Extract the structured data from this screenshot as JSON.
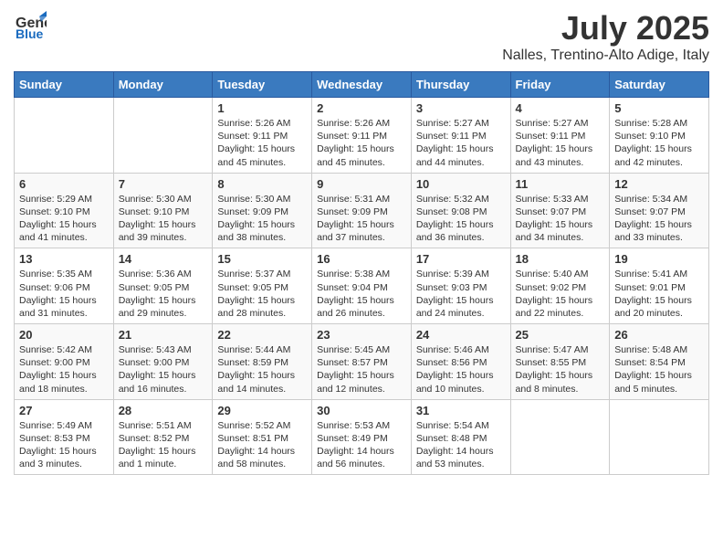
{
  "header": {
    "logo_general": "General",
    "logo_blue": "Blue",
    "title": "July 2025",
    "subtitle": "Nalles, Trentino-Alto Adige, Italy"
  },
  "days_of_week": [
    "Sunday",
    "Monday",
    "Tuesday",
    "Wednesday",
    "Thursday",
    "Friday",
    "Saturday"
  ],
  "weeks": [
    [
      {
        "day": "",
        "sunrise": "",
        "sunset": "",
        "daylight": ""
      },
      {
        "day": "",
        "sunrise": "",
        "sunset": "",
        "daylight": ""
      },
      {
        "day": "1",
        "sunrise": "Sunrise: 5:26 AM",
        "sunset": "Sunset: 9:11 PM",
        "daylight": "Daylight: 15 hours and 45 minutes."
      },
      {
        "day": "2",
        "sunrise": "Sunrise: 5:26 AM",
        "sunset": "Sunset: 9:11 PM",
        "daylight": "Daylight: 15 hours and 45 minutes."
      },
      {
        "day": "3",
        "sunrise": "Sunrise: 5:27 AM",
        "sunset": "Sunset: 9:11 PM",
        "daylight": "Daylight: 15 hours and 44 minutes."
      },
      {
        "day": "4",
        "sunrise": "Sunrise: 5:27 AM",
        "sunset": "Sunset: 9:11 PM",
        "daylight": "Daylight: 15 hours and 43 minutes."
      },
      {
        "day": "5",
        "sunrise": "Sunrise: 5:28 AM",
        "sunset": "Sunset: 9:10 PM",
        "daylight": "Daylight: 15 hours and 42 minutes."
      }
    ],
    [
      {
        "day": "6",
        "sunrise": "Sunrise: 5:29 AM",
        "sunset": "Sunset: 9:10 PM",
        "daylight": "Daylight: 15 hours and 41 minutes."
      },
      {
        "day": "7",
        "sunrise": "Sunrise: 5:30 AM",
        "sunset": "Sunset: 9:10 PM",
        "daylight": "Daylight: 15 hours and 39 minutes."
      },
      {
        "day": "8",
        "sunrise": "Sunrise: 5:30 AM",
        "sunset": "Sunset: 9:09 PM",
        "daylight": "Daylight: 15 hours and 38 minutes."
      },
      {
        "day": "9",
        "sunrise": "Sunrise: 5:31 AM",
        "sunset": "Sunset: 9:09 PM",
        "daylight": "Daylight: 15 hours and 37 minutes."
      },
      {
        "day": "10",
        "sunrise": "Sunrise: 5:32 AM",
        "sunset": "Sunset: 9:08 PM",
        "daylight": "Daylight: 15 hours and 36 minutes."
      },
      {
        "day": "11",
        "sunrise": "Sunrise: 5:33 AM",
        "sunset": "Sunset: 9:07 PM",
        "daylight": "Daylight: 15 hours and 34 minutes."
      },
      {
        "day": "12",
        "sunrise": "Sunrise: 5:34 AM",
        "sunset": "Sunset: 9:07 PM",
        "daylight": "Daylight: 15 hours and 33 minutes."
      }
    ],
    [
      {
        "day": "13",
        "sunrise": "Sunrise: 5:35 AM",
        "sunset": "Sunset: 9:06 PM",
        "daylight": "Daylight: 15 hours and 31 minutes."
      },
      {
        "day": "14",
        "sunrise": "Sunrise: 5:36 AM",
        "sunset": "Sunset: 9:05 PM",
        "daylight": "Daylight: 15 hours and 29 minutes."
      },
      {
        "day": "15",
        "sunrise": "Sunrise: 5:37 AM",
        "sunset": "Sunset: 9:05 PM",
        "daylight": "Daylight: 15 hours and 28 minutes."
      },
      {
        "day": "16",
        "sunrise": "Sunrise: 5:38 AM",
        "sunset": "Sunset: 9:04 PM",
        "daylight": "Daylight: 15 hours and 26 minutes."
      },
      {
        "day": "17",
        "sunrise": "Sunrise: 5:39 AM",
        "sunset": "Sunset: 9:03 PM",
        "daylight": "Daylight: 15 hours and 24 minutes."
      },
      {
        "day": "18",
        "sunrise": "Sunrise: 5:40 AM",
        "sunset": "Sunset: 9:02 PM",
        "daylight": "Daylight: 15 hours and 22 minutes."
      },
      {
        "day": "19",
        "sunrise": "Sunrise: 5:41 AM",
        "sunset": "Sunset: 9:01 PM",
        "daylight": "Daylight: 15 hours and 20 minutes."
      }
    ],
    [
      {
        "day": "20",
        "sunrise": "Sunrise: 5:42 AM",
        "sunset": "Sunset: 9:00 PM",
        "daylight": "Daylight: 15 hours and 18 minutes."
      },
      {
        "day": "21",
        "sunrise": "Sunrise: 5:43 AM",
        "sunset": "Sunset: 9:00 PM",
        "daylight": "Daylight: 15 hours and 16 minutes."
      },
      {
        "day": "22",
        "sunrise": "Sunrise: 5:44 AM",
        "sunset": "Sunset: 8:59 PM",
        "daylight": "Daylight: 15 hours and 14 minutes."
      },
      {
        "day": "23",
        "sunrise": "Sunrise: 5:45 AM",
        "sunset": "Sunset: 8:57 PM",
        "daylight": "Daylight: 15 hours and 12 minutes."
      },
      {
        "day": "24",
        "sunrise": "Sunrise: 5:46 AM",
        "sunset": "Sunset: 8:56 PM",
        "daylight": "Daylight: 15 hours and 10 minutes."
      },
      {
        "day": "25",
        "sunrise": "Sunrise: 5:47 AM",
        "sunset": "Sunset: 8:55 PM",
        "daylight": "Daylight: 15 hours and 8 minutes."
      },
      {
        "day": "26",
        "sunrise": "Sunrise: 5:48 AM",
        "sunset": "Sunset: 8:54 PM",
        "daylight": "Daylight: 15 hours and 5 minutes."
      }
    ],
    [
      {
        "day": "27",
        "sunrise": "Sunrise: 5:49 AM",
        "sunset": "Sunset: 8:53 PM",
        "daylight": "Daylight: 15 hours and 3 minutes."
      },
      {
        "day": "28",
        "sunrise": "Sunrise: 5:51 AM",
        "sunset": "Sunset: 8:52 PM",
        "daylight": "Daylight: 15 hours and 1 minute."
      },
      {
        "day": "29",
        "sunrise": "Sunrise: 5:52 AM",
        "sunset": "Sunset: 8:51 PM",
        "daylight": "Daylight: 14 hours and 58 minutes."
      },
      {
        "day": "30",
        "sunrise": "Sunrise: 5:53 AM",
        "sunset": "Sunset: 8:49 PM",
        "daylight": "Daylight: 14 hours and 56 minutes."
      },
      {
        "day": "31",
        "sunrise": "Sunrise: 5:54 AM",
        "sunset": "Sunset: 8:48 PM",
        "daylight": "Daylight: 14 hours and 53 minutes."
      },
      {
        "day": "",
        "sunrise": "",
        "sunset": "",
        "daylight": ""
      },
      {
        "day": "",
        "sunrise": "",
        "sunset": "",
        "daylight": ""
      }
    ]
  ]
}
